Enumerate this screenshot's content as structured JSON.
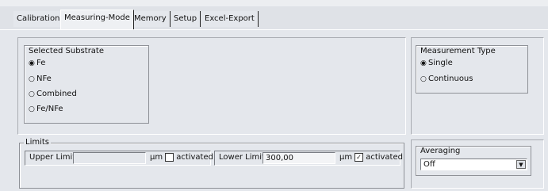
{
  "tabs": [
    {
      "label": "Calibration",
      "active": false
    },
    {
      "label": "Measuring-Mode",
      "active": true
    },
    {
      "label": "Memory",
      "active": false
    },
    {
      "label": "Setup",
      "active": false
    },
    {
      "label": "Excel-Export",
      "active": false
    }
  ],
  "substrate": {
    "title": "Selected Substrate",
    "options": [
      "Fe",
      "NFe",
      "Combined",
      "Fe/NFe"
    ],
    "selected": "Fe"
  },
  "measurement_type": {
    "title": "Measurement Type",
    "options": [
      "Single",
      "Continuous"
    ],
    "selected": "Single"
  },
  "limits": {
    "title": "Limits",
    "upper": {
      "label": "Upper Limit",
      "value": "",
      "unit": "µm",
      "check_label": "activated",
      "checked": false
    },
    "lower": {
      "label": "Lower Limit",
      "value": "300,00",
      "unit": "µm",
      "check_label": "activated",
      "checked": true
    }
  },
  "averaging": {
    "title": "Averaging",
    "selected": "Off"
  },
  "glyphs": {
    "radio_on": "◉",
    "radio_off": "○",
    "check_on": "✓",
    "dropdown": "▼"
  }
}
